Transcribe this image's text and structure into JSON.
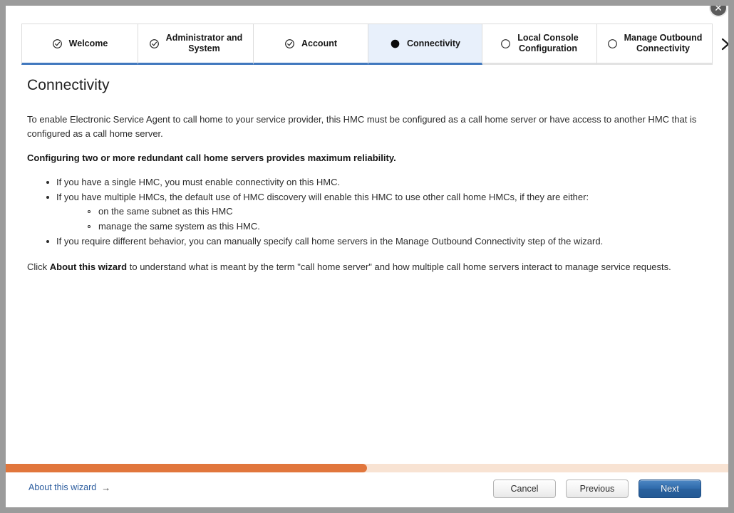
{
  "window": {
    "close_label": "✕"
  },
  "tabs": [
    {
      "label": "Welcome",
      "state": "completed",
      "icon": "check-circle-icon",
      "width_class": "w-welcome"
    },
    {
      "label": "Administrator and\nSystem",
      "state": "completed",
      "icon": "check-circle-icon",
      "width_class": "w-admin"
    },
    {
      "label": "Account",
      "state": "completed",
      "icon": "check-circle-icon",
      "width_class": "w-account"
    },
    {
      "label": "Connectivity",
      "state": "active",
      "icon": "filled-circle-icon",
      "width_class": "w-conn"
    },
    {
      "label": "Local Console\nConfiguration",
      "state": "pending",
      "icon": "empty-circle-icon",
      "width_class": "w-console"
    },
    {
      "label": "Manage Outbound\nConnectivity",
      "state": "pending",
      "icon": "empty-circle-icon",
      "width_class": "w-outbound"
    }
  ],
  "tabstrip": {
    "next_arrow_icon": "chevron-right-icon"
  },
  "main": {
    "title": "Connectivity",
    "intro": "To enable Electronic Service Agent to call home to your service provider, this HMC must be configured as a call home server or have access to another HMC that is configured as a call home server.",
    "emphasis": "Configuring two or more redundant call home servers provides maximum reliability.",
    "bullets": [
      "If you have a single HMC, you must enable connectivity on this HMC.",
      "If you have multiple HMCs, the default use of HMC discovery will enable this HMC to use other call home HMCs, if they are either:",
      "If you require different behavior, you can manually specify call home servers in the Manage Outbound Connectivity step of the wizard."
    ],
    "subbullets": [
      "on the same subnet as this HMC",
      "manage the same system as this HMC."
    ],
    "closing_prefix": "Click ",
    "closing_bold": "About this wizard",
    "closing_suffix": " to understand what is meant by the term \"call home server\" and how multiple call home servers interact to manage service requests."
  },
  "progress": {
    "percent": 50,
    "fill_color": "#e1763c",
    "track_color": "#f8e3d3"
  },
  "footer": {
    "about_link": "About this wizard",
    "about_arrow": "→",
    "cancel_label": "Cancel",
    "previous_label": "Previous",
    "next_label": "Next"
  }
}
